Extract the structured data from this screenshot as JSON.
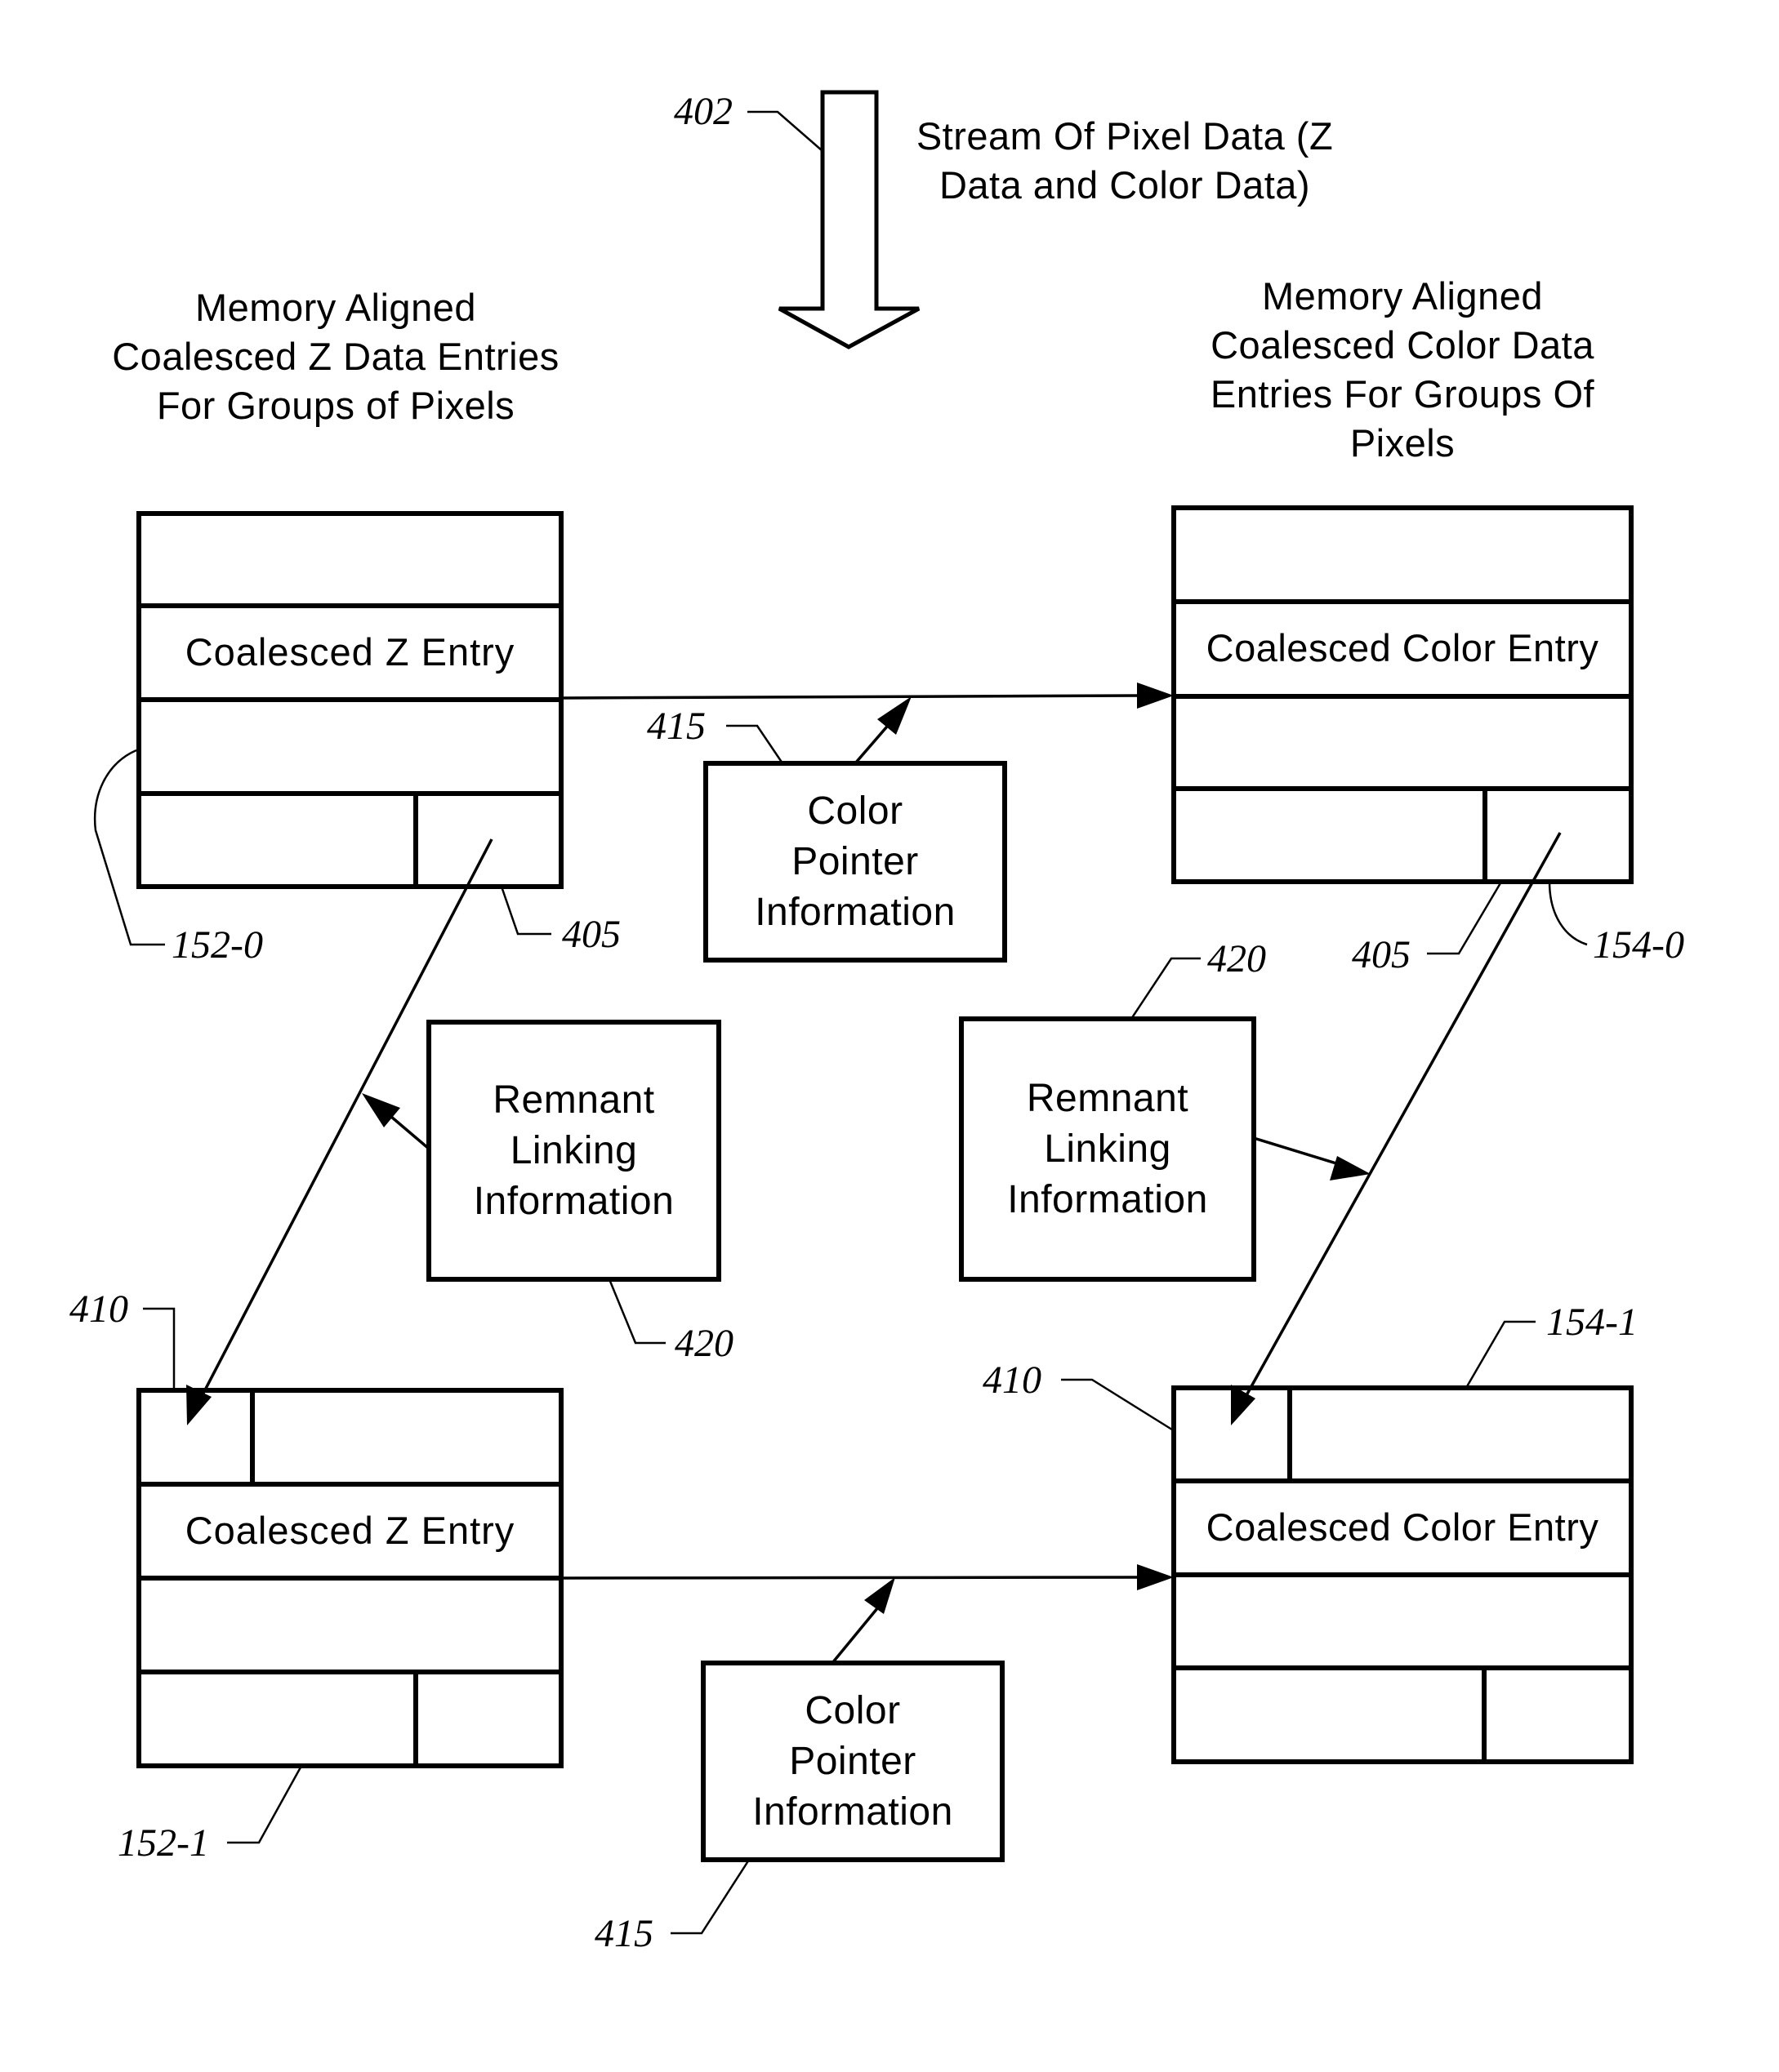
{
  "stream": {
    "ref": "402",
    "label_lines": [
      "Stream Of Pixel Data (Z",
      "Data and Color Data)"
    ]
  },
  "z_column": {
    "header_lines": [
      "Memory Aligned",
      "Coalesced Z Data Entries",
      "For Groups of Pixels"
    ],
    "entries": [
      {
        "ref": "152-0",
        "label": "Coalesced Z Entry",
        "pointer_ref": "405"
      },
      {
        "ref": "152-1",
        "label": "Coalesced Z Entry",
        "link_target_ref": "410"
      }
    ]
  },
  "color_column": {
    "header_lines": [
      "Memory Aligned",
      "Coalesced Color Data",
      "Entries For Groups Of",
      "Pixels"
    ],
    "entries": [
      {
        "ref": "154-0",
        "label": "Coalesced Color Entry",
        "pointer_ref": "405"
      },
      {
        "ref": "154-1",
        "label": "Coalesced Color Entry",
        "link_target_ref": "410"
      }
    ]
  },
  "color_pointer_boxes": [
    {
      "ref": "415",
      "lines": [
        "Color",
        "Pointer",
        "Information"
      ]
    },
    {
      "ref": "415",
      "lines": [
        "Color",
        "Pointer",
        "Information"
      ]
    }
  ],
  "remnant_boxes": [
    {
      "ref": "420",
      "lines": [
        "Remnant",
        "Linking",
        "Information"
      ]
    },
    {
      "ref": "420",
      "lines": [
        "Remnant",
        "Linking",
        "Information"
      ]
    }
  ]
}
